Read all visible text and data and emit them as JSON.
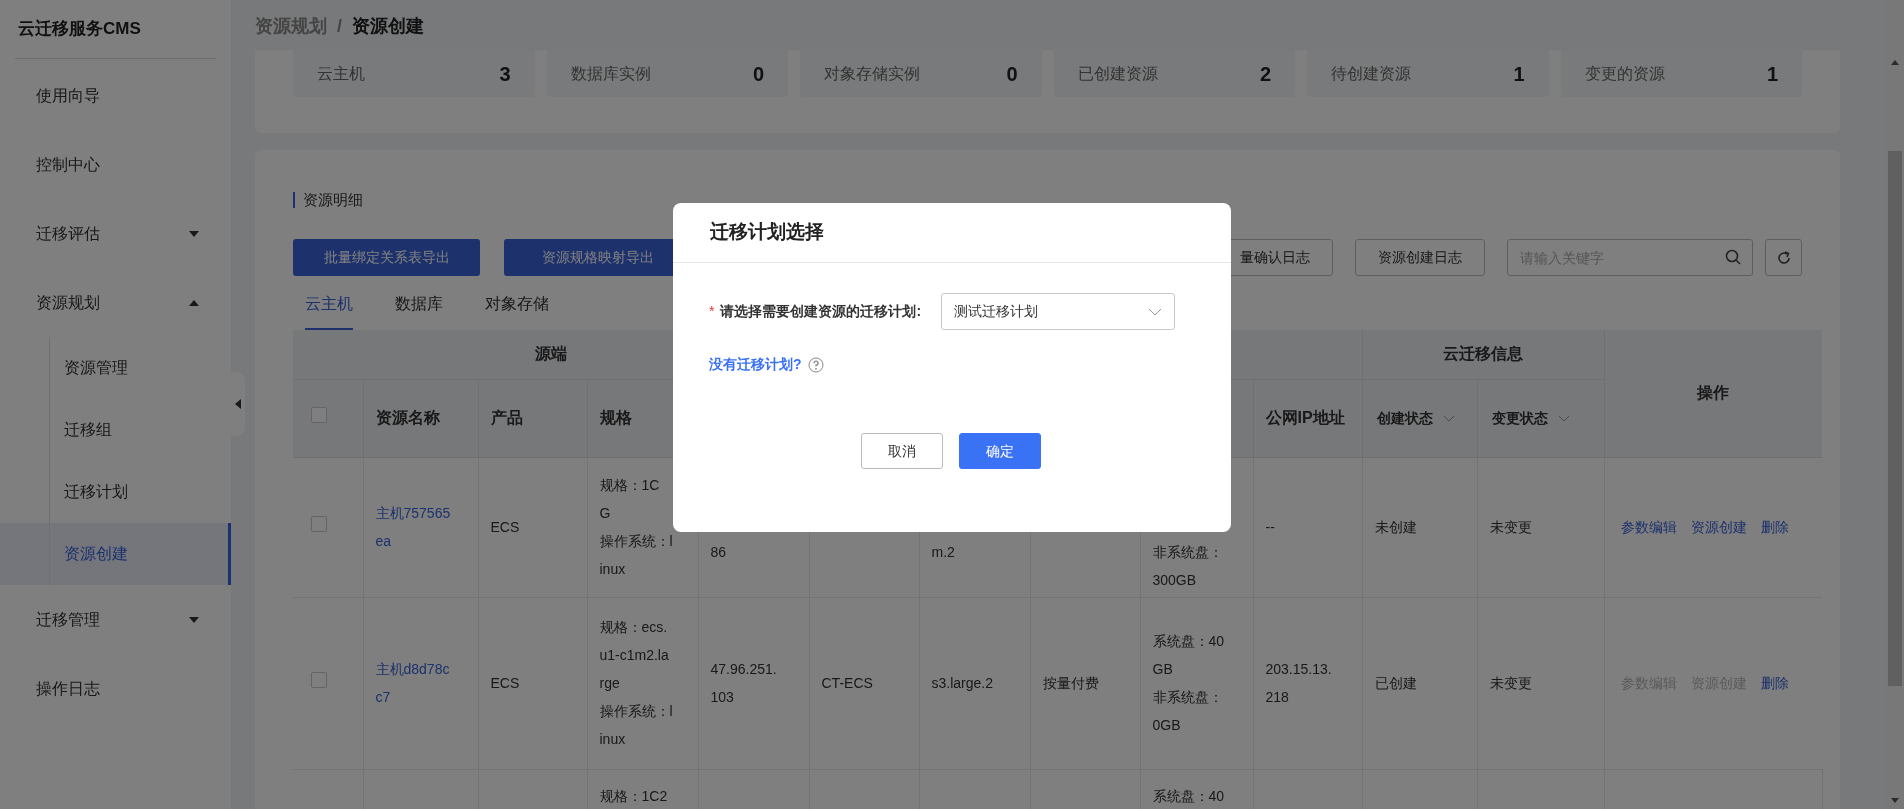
{
  "sidebar": {
    "title": "云迁移服务CMS",
    "items": [
      {
        "label": "使用向导",
        "selected": false
      },
      {
        "label": "控制中心",
        "selected": false
      },
      {
        "label": "迁移评估",
        "selected": false,
        "expanded": false
      },
      {
        "label": "资源规划",
        "selected": false,
        "expanded": true,
        "children": [
          {
            "label": "资源管理",
            "selected": false
          },
          {
            "label": "迁移组",
            "selected": false
          },
          {
            "label": "迁移计划",
            "selected": false
          },
          {
            "label": "资源创建",
            "selected": true
          }
        ]
      },
      {
        "label": "迁移管理",
        "selected": false,
        "expanded": false
      },
      {
        "label": "操作日志",
        "selected": false
      }
    ]
  },
  "breadcrumb": [
    "资源规划",
    "/",
    "资源创建"
  ],
  "stats": [
    {
      "label": "云主机",
      "value": "3"
    },
    {
      "label": "数据库实例",
      "value": "0"
    },
    {
      "label": "对象存储实例",
      "value": "0"
    },
    {
      "label": "已创建资源",
      "value": "2"
    },
    {
      "label": "待创建资源",
      "value": "1"
    },
    {
      "label": "变更的资源",
      "value": "1"
    }
  ],
  "section_title": "资源明细",
  "toolbar": {
    "primary_buttons": [
      "批量绑定关系表导出",
      "资源规格映射导出"
    ],
    "buttons": [
      "量确认日志",
      "资源创建日志"
    ],
    "search": {
      "placeholder": "请输入关键字"
    }
  },
  "tabs": [
    {
      "label": "云主机",
      "selected": true
    },
    {
      "label": "数据库",
      "selected": false
    },
    {
      "label": "对象存储",
      "selected": false
    }
  ],
  "table": {
    "header_groups": [
      {
        "kind": "group",
        "label": "源端",
        "columns": [
          {
            "kind": "checkbox",
            "checked": false
          },
          {
            "kind": "text",
            "label": "资源名称"
          },
          {
            "kind": "text",
            "label": "产品"
          },
          {
            "kind": "text",
            "label": "规格"
          },
          {
            "kind": "covered"
          }
        ]
      },
      {
        "kind": "group",
        "columns": [
          {
            "kind": "covered"
          },
          {
            "kind": "covered"
          },
          {
            "kind": "covered"
          },
          {
            "kind": "covered"
          },
          {
            "kind": "text",
            "label": "公网IP地址"
          }
        ]
      },
      {
        "kind": "group",
        "label": "云迁移信息",
        "columns": [
          {
            "kind": "filter",
            "label": "创建状态"
          },
          {
            "kind": "filter",
            "label": "变更状态"
          }
        ]
      },
      {
        "kind": "single",
        "label": "操作"
      }
    ],
    "rows": [
      {
        "kind": "full",
        "checked": false,
        "cells": {
          "name": {
            "lines": [
              "主机757565",
              "ea"
            ],
            "link": true
          },
          "product": {
            "lines": [
              "ECS"
            ]
          },
          "spec": {
            "lines": [
              "规格：1C",
              "G",
              "操作系统：l",
              "inux"
            ]
          },
          "column_5": {
            "lines": [
              "86"
            ],
            "covered": true
          },
          "column_7": {
            "lines": [
              "m.2"
            ],
            "covered": true
          },
          "column_9": {
            "lines": [
              "非系统盘：",
              "300GB"
            ],
            "covered": true
          },
          "public_ip": {
            "lines": [
              "--"
            ]
          },
          "create_status": {
            "lines": [
              "未创建"
            ]
          },
          "change_status": {
            "lines": [
              "未变更"
            ]
          },
          "actions": {
            "actions": [
              {
                "label": "参数编辑",
                "disabled": false
              },
              {
                "label": "资源创建",
                "disabled": false
              },
              {
                "label": "删除",
                "disabled": false
              }
            ]
          }
        }
      },
      {
        "kind": "full",
        "checked": false,
        "cells": {
          "name": {
            "lines": [
              "主机d8d78c",
              "c7"
            ],
            "link": true
          },
          "product": {
            "lines": [
              "ECS"
            ]
          },
          "spec": {
            "lines": [
              "规格：ecs.",
              "u1-c1m2.la",
              "rge",
              "操作系统：l",
              "inux"
            ]
          },
          "column_5": {
            "lines": [
              "47.96.251.",
              "103"
            ]
          },
          "column_6": {
            "lines": [
              "CT-ECS"
            ]
          },
          "column_7": {
            "lines": [
              "s3.large.2"
            ]
          },
          "column_8": {
            "lines": [
              "按量付费"
            ]
          },
          "column_9": {
            "lines": [
              "系统盘：40",
              "GB",
              "非系统盘：",
              "0GB"
            ]
          },
          "public_ip": {
            "lines": [
              "203.15.13.",
              "218"
            ]
          },
          "create_status": {
            "lines": [
              "已创建"
            ]
          },
          "change_status": {
            "lines": [
              "未变更"
            ]
          },
          "actions": {
            "actions": [
              {
                "label": "参数编辑",
                "disabled": true
              },
              {
                "label": "资源创建",
                "disabled": true
              },
              {
                "label": "删除",
                "disabled": false
              }
            ]
          }
        }
      },
      {
        "kind": "cut_off",
        "cells": {
          "spec": {
            "lines": [
              "规格：1C2"
            ]
          },
          "column_9": {
            "lines": [
              "系统盘：40"
            ]
          }
        }
      }
    ]
  },
  "dialog": {
    "title": "迁移计划选择",
    "field": {
      "required_mark": "*",
      "label": "请选择需要创建资源的迁移计划:",
      "value": "测试迁移计划"
    },
    "help_link": "没有迁移计划?",
    "buttons": [
      {
        "kind": "secondary",
        "label": "取消"
      },
      {
        "kind": "primary",
        "label": "确定"
      }
    ]
  }
}
